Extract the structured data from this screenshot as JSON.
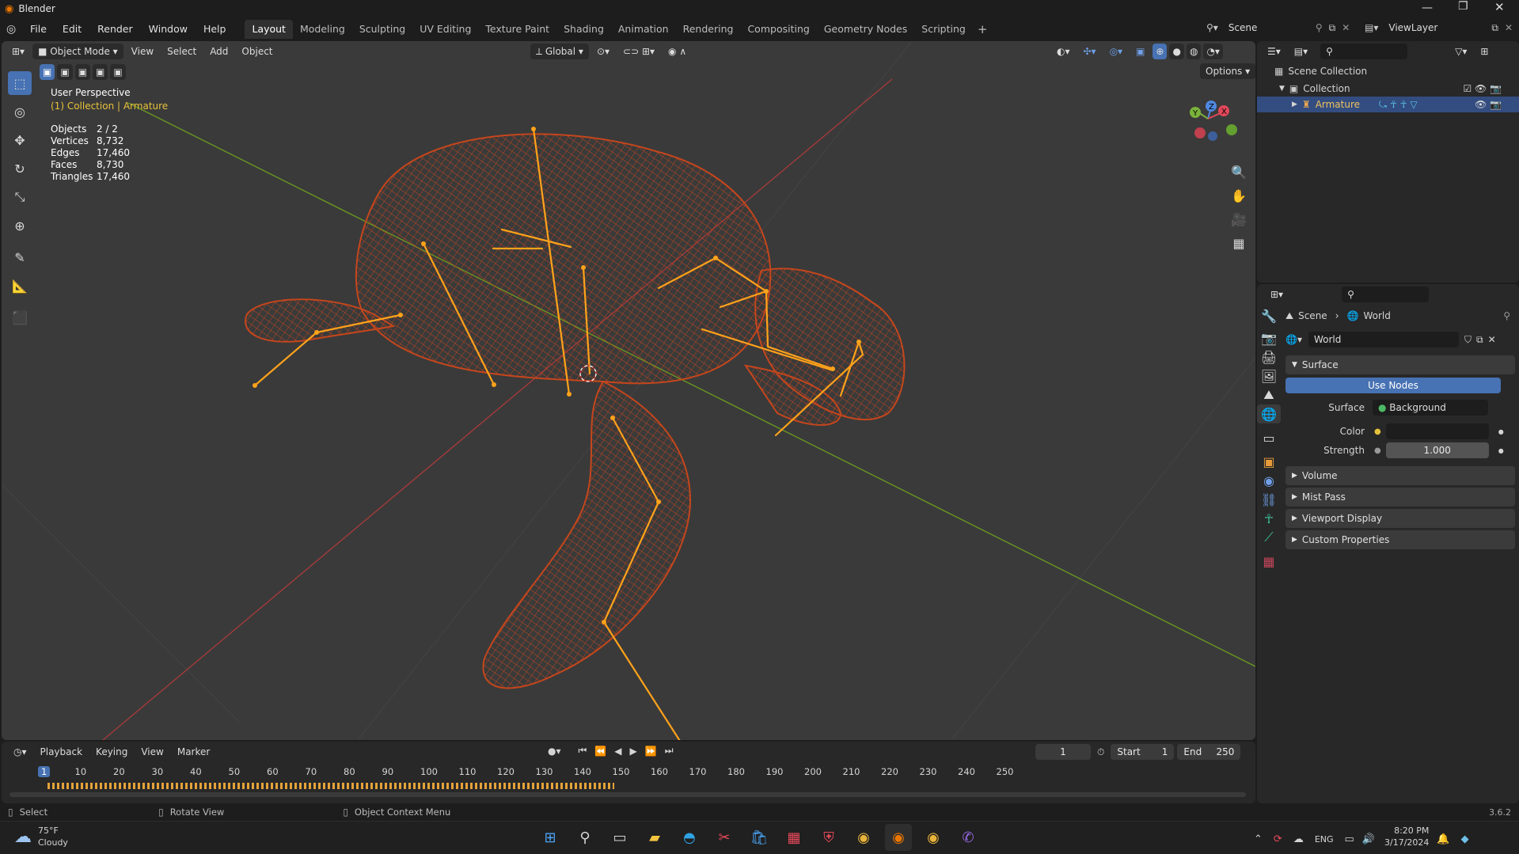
{
  "app": {
    "title": "Blender",
    "version": "3.6.2"
  },
  "menu": {
    "items": [
      "File",
      "Edit",
      "Render",
      "Window",
      "Help"
    ]
  },
  "workspaces": {
    "tabs": [
      "Layout",
      "Modeling",
      "Sculpting",
      "UV Editing",
      "Texture Paint",
      "Shading",
      "Animation",
      "Rendering",
      "Compositing",
      "Geometry Nodes",
      "Scripting"
    ],
    "active": "Layout",
    "add": "+"
  },
  "scene": {
    "name": "Scene",
    "view_layer": "ViewLayer"
  },
  "viewport": {
    "mode": "Object Mode",
    "menus": [
      "View",
      "Select",
      "Add",
      "Object"
    ],
    "orientation": "Global",
    "options_label": "Options",
    "overlay_title": "User Perspective",
    "overlay_sub": "(1) Collection | Armature",
    "stats": [
      {
        "label": "Objects",
        "value": "2 / 2"
      },
      {
        "label": "Vertices",
        "value": "8,732"
      },
      {
        "label": "Edges",
        "value": "17,460"
      },
      {
        "label": "Faces",
        "value": "8,730"
      },
      {
        "label": "Triangles",
        "value": "17,460"
      }
    ],
    "gizmo": {
      "x": "X",
      "y": "Y",
      "z": "Z"
    },
    "colors": {
      "bg": "#3a3a3a",
      "mesh": "#c5461c",
      "bone": "#ffa31a",
      "xaxis": "#a33a3a",
      "yaxis": "#6a9a21"
    }
  },
  "outliner": {
    "root": "Scene Collection",
    "collection": "Collection",
    "object": "Armature"
  },
  "properties": {
    "breadcrumb": [
      "Scene",
      "World"
    ],
    "world_name": "World",
    "surface_panel": "Surface",
    "use_nodes": "Use Nodes",
    "surface_label": "Surface",
    "surface_value": "Background",
    "color_label": "Color",
    "strength_label": "Strength",
    "strength_value": "1.000",
    "collapsed_panels": [
      "Volume",
      "Mist Pass",
      "Viewport Display",
      "Custom Properties"
    ]
  },
  "timeline": {
    "menus": [
      "Playback",
      "Keying",
      "View",
      "Marker"
    ],
    "current_frame": "1",
    "start_label": "Start",
    "start": "1",
    "end_label": "End",
    "end": "250",
    "ticks": [
      "1",
      "10",
      "20",
      "30",
      "40",
      "50",
      "60",
      "70",
      "80",
      "90",
      "100",
      "110",
      "120",
      "130",
      "140",
      "150",
      "160",
      "170",
      "180",
      "190",
      "200",
      "210",
      "220",
      "230",
      "240",
      "250"
    ]
  },
  "status": {
    "items": [
      {
        "icon": "mouse-left-icon",
        "label": "Select"
      },
      {
        "icon": "mouse-middle-icon",
        "label": "Rotate View"
      },
      {
        "icon": "mouse-right-icon",
        "label": "Object Context Menu"
      }
    ],
    "version": "3.6.2"
  },
  "taskbar": {
    "weather_temp": "75°F",
    "weather_desc": "Cloudy",
    "lang": "ENG",
    "time": "8:20 PM",
    "date": "3/17/2024"
  }
}
